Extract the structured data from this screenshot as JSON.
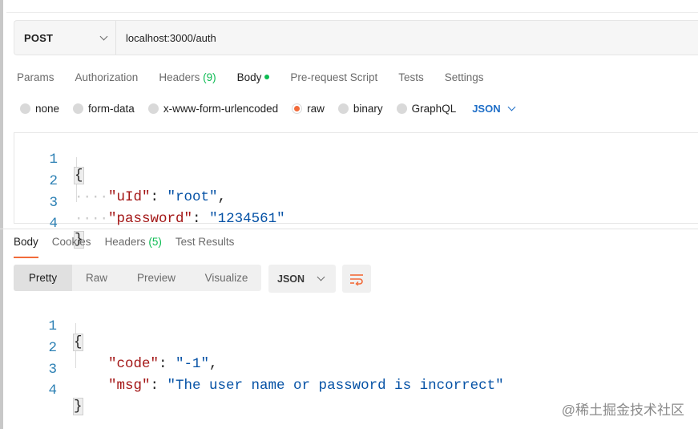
{
  "request": {
    "method": "POST",
    "url": "localhost:3000/auth",
    "tabs": [
      {
        "label": "Params"
      },
      {
        "label": "Authorization"
      },
      {
        "label": "Headers",
        "count": "(9)"
      },
      {
        "label": "Body"
      },
      {
        "label": "Pre-request Script"
      },
      {
        "label": "Tests"
      },
      {
        "label": "Settings"
      }
    ],
    "active_tab": "Body",
    "body_types": [
      "none",
      "form-data",
      "x-www-form-urlencoded",
      "raw",
      "binary",
      "GraphQL"
    ],
    "selected_body_type": "raw",
    "format": "JSON",
    "code": {
      "line_numbers": [
        "1",
        "2",
        "3",
        "4"
      ],
      "open_brace": "{",
      "close_brace": "}",
      "indent": "····",
      "key1": "\"uId\"",
      "val1": "\"root\"",
      "key2": "\"password\"",
      "val2": "\"1234561\""
    }
  },
  "response": {
    "tabs": [
      {
        "label": "Body"
      },
      {
        "label": "Cookies"
      },
      {
        "label": "Headers",
        "count": "(5)"
      },
      {
        "label": "Test Results"
      }
    ],
    "active_tab": "Body",
    "view_modes": [
      "Pretty",
      "Raw",
      "Preview",
      "Visualize"
    ],
    "active_view_mode": "Pretty",
    "format": "JSON",
    "code": {
      "line_numbers": [
        "1",
        "2",
        "3",
        "4"
      ],
      "open_brace": "{",
      "close_brace": "}",
      "key1": "\"code\"",
      "val1": "\"-1\"",
      "key2": "\"msg\"",
      "val2": "\"The user name or password is incorrect\""
    }
  },
  "watermark": "@稀土掘金技术社区",
  "colors": {
    "accent": "#f26b3a",
    "count_green": "#0cbb52",
    "json_blue": "#1e6ec7",
    "key_red": "#a31515",
    "string_blue": "#0451a5",
    "line_number": "#2c80b4"
  },
  "icons": {
    "method_dropdown": "chevron-down-icon",
    "format_dropdown": "chevron-down-icon",
    "wrap": "wrap-lines-icon"
  }
}
